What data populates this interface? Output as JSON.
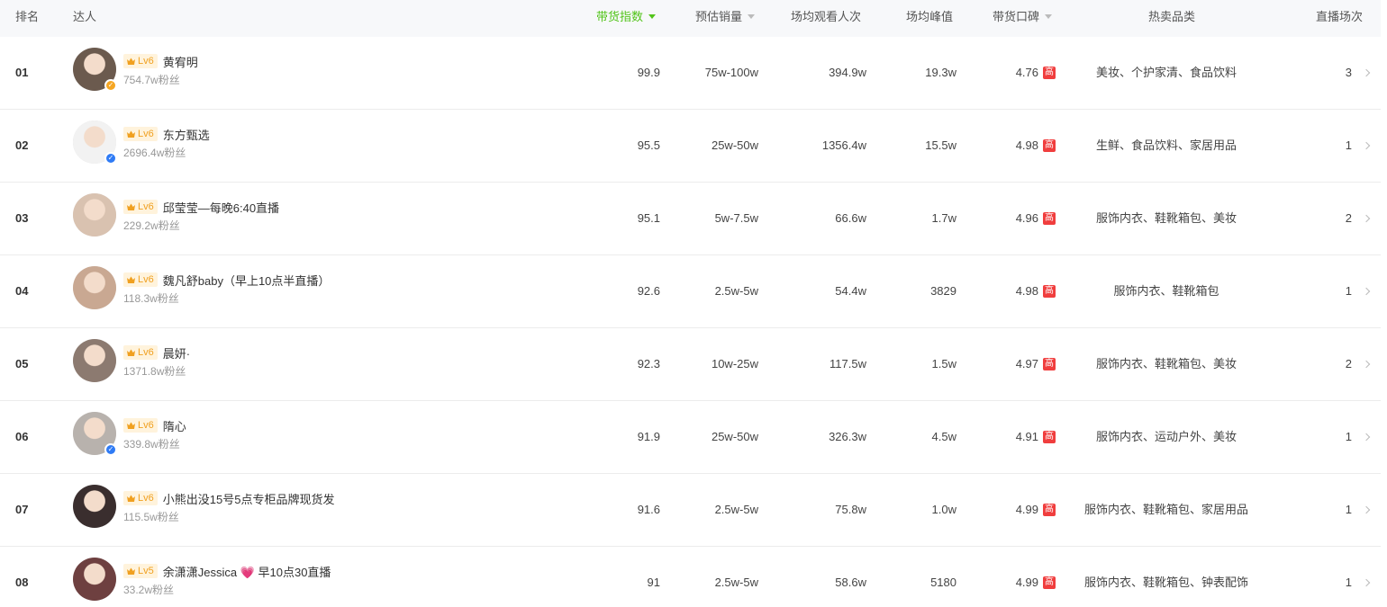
{
  "header": {
    "rank": "排名",
    "talent": "达人",
    "sales_index": "带货指数",
    "est_sales": "预估销量",
    "avg_views": "场均观看人次",
    "avg_peak": "场均峰值",
    "reputation": "带货口碑",
    "hot_categories": "热卖品类",
    "live_count": "直播场次"
  },
  "rows": [
    {
      "rank": "01",
      "level": "Lv6",
      "name": "黄宥明",
      "fans": "754.7w粉丝",
      "verify": "gold",
      "index": "99.9",
      "sales": "75w-100w",
      "views": "394.9w",
      "peak": "19.3w",
      "rating": "4.76",
      "rating_tag": "高",
      "categories": "美妆、个护家清、食品饮料",
      "live_count": "3"
    },
    {
      "rank": "02",
      "level": "Lv6",
      "name": "东方甄选",
      "fans": "2696.4w粉丝",
      "verify": "blue",
      "index": "95.5",
      "sales": "25w-50w",
      "views": "1356.4w",
      "peak": "15.5w",
      "rating": "4.98",
      "rating_tag": "高",
      "categories": "生鲜、食品饮料、家居用品",
      "live_count": "1"
    },
    {
      "rank": "03",
      "level": "Lv6",
      "name": "邱莹莹—每晚6:40直播",
      "fans": "229.2w粉丝",
      "verify": "",
      "index": "95.1",
      "sales": "5w-7.5w",
      "views": "66.6w",
      "peak": "1.7w",
      "rating": "4.96",
      "rating_tag": "高",
      "categories": "服饰内衣、鞋靴箱包、美妆",
      "live_count": "2"
    },
    {
      "rank": "04",
      "level": "Lv6",
      "name": "魏凡舒baby（早上10点半直播）",
      "fans": "118.3w粉丝",
      "verify": "",
      "index": "92.6",
      "sales": "2.5w-5w",
      "views": "54.4w",
      "peak": "3829",
      "rating": "4.98",
      "rating_tag": "高",
      "categories": "服饰内衣、鞋靴箱包",
      "live_count": "1"
    },
    {
      "rank": "05",
      "level": "Lv6",
      "name": "晨妍·",
      "fans": "1371.8w粉丝",
      "verify": "",
      "index": "92.3",
      "sales": "10w-25w",
      "views": "117.5w",
      "peak": "1.5w",
      "rating": "4.97",
      "rating_tag": "高",
      "categories": "服饰内衣、鞋靴箱包、美妆",
      "live_count": "2"
    },
    {
      "rank": "06",
      "level": "Lv6",
      "name": "隋心",
      "fans": "339.8w粉丝",
      "verify": "blue",
      "index": "91.9",
      "sales": "25w-50w",
      "views": "326.3w",
      "peak": "4.5w",
      "rating": "4.91",
      "rating_tag": "高",
      "categories": "服饰内衣、运动户外、美妆",
      "live_count": "1"
    },
    {
      "rank": "07",
      "level": "Lv6",
      "name": "小熊出没15号5点专柜品牌现货发",
      "fans": "115.5w粉丝",
      "verify": "",
      "index": "91.6",
      "sales": "2.5w-5w",
      "views": "75.8w",
      "peak": "1.0w",
      "rating": "4.99",
      "rating_tag": "高",
      "categories": "服饰内衣、鞋靴箱包、家居用品",
      "live_count": "1"
    },
    {
      "rank": "08",
      "level": "Lv5",
      "name": "余潇潇Jessica 💗 早10点30直播",
      "fans": "33.2w粉丝",
      "verify": "",
      "index": "91",
      "sales": "2.5w-5w",
      "views": "58.6w",
      "peak": "5180",
      "rating": "4.99",
      "rating_tag": "高",
      "categories": "服饰内衣、鞋靴箱包、钟表配饰",
      "live_count": "1"
    }
  ],
  "colors": {
    "active_sort": "#52c41a",
    "level_badge_text": "#f0a020",
    "level_badge_bg": "#fff3dc",
    "rating_tag_bg": "#f03e3e",
    "verify_gold": "#f5a623",
    "verify_blue": "#2f7bf5"
  }
}
